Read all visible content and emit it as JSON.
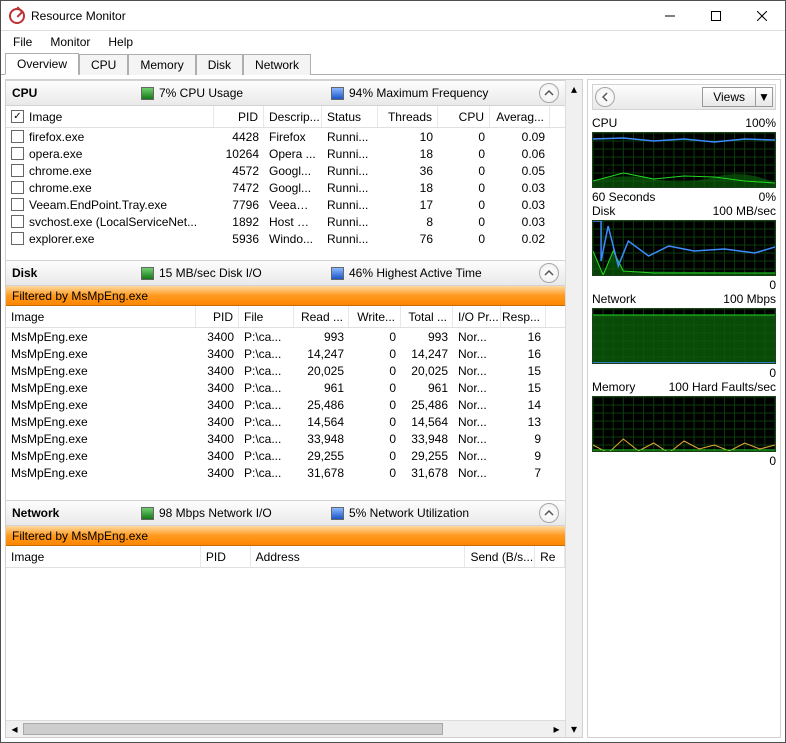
{
  "window": {
    "title": "Resource Monitor"
  },
  "menu": {
    "file": "File",
    "monitor": "Monitor",
    "help": "Help"
  },
  "tabs": {
    "overview": "Overview",
    "cpu": "CPU",
    "memory": "Memory",
    "disk": "Disk",
    "network": "Network"
  },
  "cpu_panel": {
    "title": "CPU",
    "stat1": "7% CPU Usage",
    "stat2": "94% Maximum Frequency",
    "headers": {
      "image": "Image",
      "pid": "PID",
      "desc": "Descrip...",
      "status": "Status",
      "threads": "Threads",
      "cpu": "CPU",
      "avg": "Averag..."
    },
    "rows": [
      {
        "img": "firefox.exe",
        "pid": "4428",
        "desc": "Firefox",
        "status": "Runni...",
        "threads": "10",
        "cpu": "0",
        "avg": "0.09"
      },
      {
        "img": "opera.exe",
        "pid": "10264",
        "desc": "Opera ...",
        "status": "Runni...",
        "threads": "18",
        "cpu": "0",
        "avg": "0.06"
      },
      {
        "img": "chrome.exe",
        "pid": "4572",
        "desc": "Googl...",
        "status": "Runni...",
        "threads": "36",
        "cpu": "0",
        "avg": "0.05"
      },
      {
        "img": "chrome.exe",
        "pid": "7472",
        "desc": "Googl...",
        "status": "Runni...",
        "threads": "18",
        "cpu": "0",
        "avg": "0.03"
      },
      {
        "img": "Veeam.EndPoint.Tray.exe",
        "pid": "7796",
        "desc": "Veeam ...",
        "status": "Runni...",
        "threads": "17",
        "cpu": "0",
        "avg": "0.03"
      },
      {
        "img": "svchost.exe (LocalServiceNet...",
        "pid": "1892",
        "desc": "Host Pr...",
        "status": "Runni...",
        "threads": "8",
        "cpu": "0",
        "avg": "0.03"
      },
      {
        "img": "explorer.exe",
        "pid": "5936",
        "desc": "Windo...",
        "status": "Runni...",
        "threads": "76",
        "cpu": "0",
        "avg": "0.02"
      }
    ]
  },
  "disk_panel": {
    "title": "Disk",
    "stat1": "15 MB/sec Disk I/O",
    "stat2": "46% Highest Active Time",
    "filter": "Filtered by MsMpEng.exe",
    "headers": {
      "image": "Image",
      "pid": "PID",
      "file": "File",
      "read": "Read ...",
      "write": "Write...",
      "total": "Total ...",
      "iopr": "I/O Pr...",
      "resp": "Resp..."
    },
    "rows": [
      {
        "img": "MsMpEng.exe",
        "pid": "3400",
        "file": "P:\\ca...",
        "read": "993",
        "write": "0",
        "total": "993",
        "iopr": "Nor...",
        "resp": "16"
      },
      {
        "img": "MsMpEng.exe",
        "pid": "3400",
        "file": "P:\\ca...",
        "read": "14,247",
        "write": "0",
        "total": "14,247",
        "iopr": "Nor...",
        "resp": "16"
      },
      {
        "img": "MsMpEng.exe",
        "pid": "3400",
        "file": "P:\\ca...",
        "read": "20,025",
        "write": "0",
        "total": "20,025",
        "iopr": "Nor...",
        "resp": "15"
      },
      {
        "img": "MsMpEng.exe",
        "pid": "3400",
        "file": "P:\\ca...",
        "read": "961",
        "write": "0",
        "total": "961",
        "iopr": "Nor...",
        "resp": "15"
      },
      {
        "img": "MsMpEng.exe",
        "pid": "3400",
        "file": "P:\\ca...",
        "read": "25,486",
        "write": "0",
        "total": "25,486",
        "iopr": "Nor...",
        "resp": "14"
      },
      {
        "img": "MsMpEng.exe",
        "pid": "3400",
        "file": "P:\\ca...",
        "read": "14,564",
        "write": "0",
        "total": "14,564",
        "iopr": "Nor...",
        "resp": "13"
      },
      {
        "img": "MsMpEng.exe",
        "pid": "3400",
        "file": "P:\\ca...",
        "read": "33,948",
        "write": "0",
        "total": "33,948",
        "iopr": "Nor...",
        "resp": "9"
      },
      {
        "img": "MsMpEng.exe",
        "pid": "3400",
        "file": "P:\\ca...",
        "read": "29,255",
        "write": "0",
        "total": "29,255",
        "iopr": "Nor...",
        "resp": "9"
      },
      {
        "img": "MsMpEng.exe",
        "pid": "3400",
        "file": "P:\\ca...",
        "read": "31,678",
        "write": "0",
        "total": "31,678",
        "iopr": "Nor...",
        "resp": "7"
      }
    ]
  },
  "net_panel": {
    "title": "Network",
    "stat1": "98 Mbps Network I/O",
    "stat2": "5% Network Utilization",
    "filter": "Filtered by MsMpEng.exe",
    "headers": {
      "image": "Image",
      "pid": "PID",
      "addr": "Address",
      "send": "Send (B/s...",
      "recv": "Re"
    }
  },
  "side": {
    "views": "Views",
    "charts": [
      {
        "t1": "CPU",
        "t2": "100%",
        "b1": "60 Seconds",
        "b2": "0%"
      },
      {
        "t1": "Disk",
        "t2": "100 MB/sec",
        "b1": "",
        "b2": "0"
      },
      {
        "t1": "Network",
        "t2": "100 Mbps",
        "b1": "",
        "b2": "0"
      },
      {
        "t1": "Memory",
        "t2": "100 Hard Faults/sec",
        "b1": "",
        "b2": "0"
      }
    ]
  }
}
